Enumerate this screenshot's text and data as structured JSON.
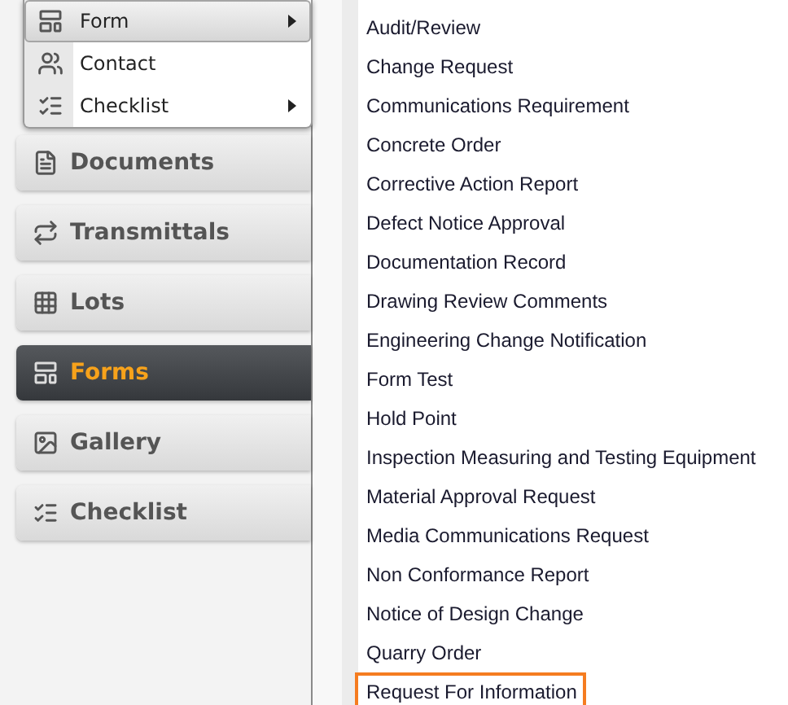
{
  "popup_menu": [
    {
      "label": "Form",
      "kind": "form",
      "selected": true,
      "has_submenu": true
    },
    {
      "label": "Contact",
      "kind": "contact",
      "selected": false,
      "has_submenu": false
    },
    {
      "label": "Checklist",
      "kind": "checklist",
      "selected": false,
      "has_submenu": true
    }
  ],
  "sidebar": {
    "items": [
      {
        "label": "Documents",
        "kind": "documents",
        "selected": false
      },
      {
        "label": "Transmittals",
        "kind": "transmittals",
        "selected": false
      },
      {
        "label": "Lots",
        "kind": "lots",
        "selected": false
      },
      {
        "label": "Forms",
        "kind": "form",
        "selected": true
      },
      {
        "label": "Gallery",
        "kind": "gallery",
        "selected": false
      },
      {
        "label": "Checklist",
        "kind": "checklist",
        "selected": false
      }
    ]
  },
  "form_list": [
    {
      "label": "Audit/Review",
      "selected": false
    },
    {
      "label": "Change Request",
      "selected": false
    },
    {
      "label": "Communications Requirement",
      "selected": false
    },
    {
      "label": "Concrete Order",
      "selected": false
    },
    {
      "label": "Corrective Action Report",
      "selected": false
    },
    {
      "label": "Defect Notice Approval",
      "selected": false
    },
    {
      "label": "Documentation Record",
      "selected": false
    },
    {
      "label": "Drawing Review Comments",
      "selected": false
    },
    {
      "label": "Engineering Change Notification",
      "selected": false
    },
    {
      "label": "Form Test",
      "selected": false
    },
    {
      "label": "Hold Point",
      "selected": false
    },
    {
      "label": "Inspection Measuring and Testing Equipment",
      "selected": false
    },
    {
      "label": "Material Approval Request",
      "selected": false
    },
    {
      "label": "Media Communications Request",
      "selected": false
    },
    {
      "label": "Non Conformance Report",
      "selected": false
    },
    {
      "label": "Notice of Design Change",
      "selected": false
    },
    {
      "label": "Quarry Order",
      "selected": false
    },
    {
      "label": "Request For Information",
      "selected": true
    }
  ]
}
